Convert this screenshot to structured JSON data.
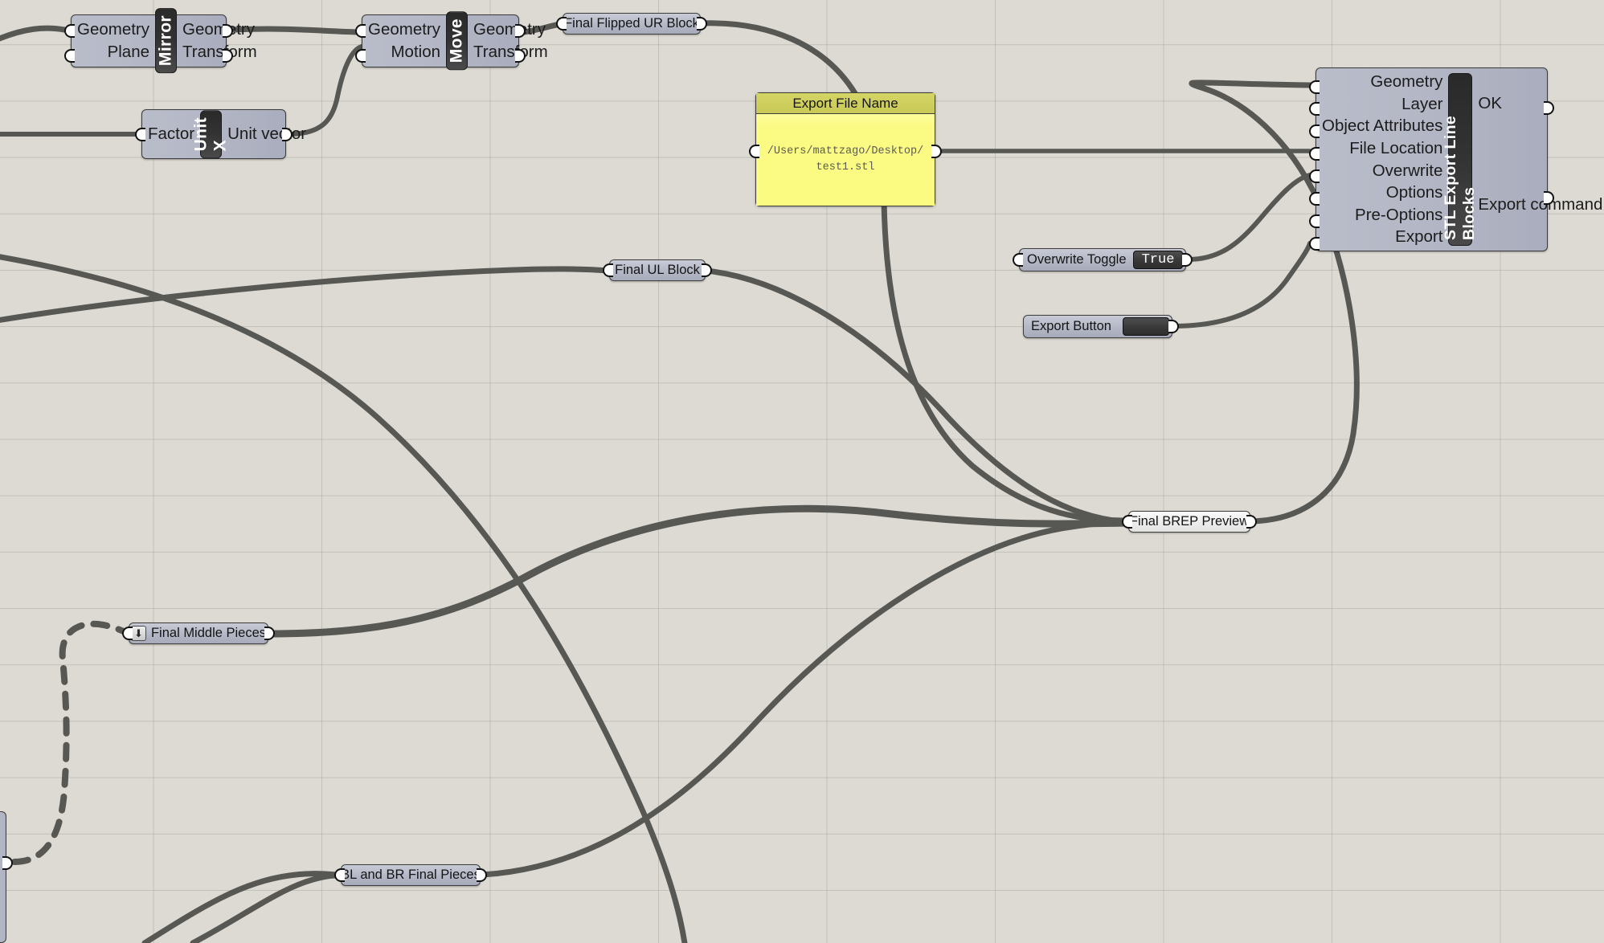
{
  "app": {
    "name": "Grasshopper Canvas",
    "background_color": "#dcdad2",
    "grid_line_color": "#96968f"
  },
  "components": [
    {
      "id": "mirror",
      "name": "Mirror",
      "nameplate": "Mirror",
      "inputs": [
        "Geometry",
        "Plane"
      ],
      "outputs": [
        "Geometry",
        "Transform"
      ]
    },
    {
      "id": "move",
      "name": "Move",
      "nameplate": "Move",
      "inputs": [
        "Geometry",
        "Motion"
      ],
      "outputs": [
        "Geometry",
        "Transform"
      ]
    },
    {
      "id": "unitx",
      "name": "Unit X",
      "nameplate": "Unit X",
      "inputs": [
        "Factor"
      ],
      "outputs": [
        "Unit vector"
      ]
    },
    {
      "id": "stl_export",
      "name": "STL Export Line Blocks",
      "nameplate": "STL Export Line Blocks",
      "inputs": [
        "Geometry",
        "Layer",
        "Object Attributes",
        "File Location",
        "Overwrite",
        "Options",
        "Pre-Options",
        "Export"
      ],
      "outputs": [
        "OK",
        "Export command"
      ]
    }
  ],
  "panel": {
    "title": "Export File Name",
    "value": "/Users/mattzago/Desktop/test1.stl",
    "header_color": "#cdcd5c",
    "body_color": "#fbfb84"
  },
  "widgets": [
    {
      "id": "overwrite_toggle",
      "label": "Overwrite Toggle",
      "value": "True",
      "kind": "boolean-toggle"
    },
    {
      "id": "export_button",
      "label": "Export Button",
      "value": "",
      "kind": "momentary-button"
    }
  ],
  "relays": [
    {
      "id": "final_flipped_ur",
      "label": "Final Flipped UR Block",
      "icon": "",
      "style": "default"
    },
    {
      "id": "final_ul",
      "label": "Final UL Block",
      "icon": "",
      "style": "default"
    },
    {
      "id": "final_middle",
      "label": "Final Middle Pieces",
      "icon": "arrow-down-icon",
      "icon_glyph": "⬇",
      "style": "default"
    },
    {
      "id": "final_brep",
      "label": "Final BREP Preview",
      "icon": "",
      "style": "light"
    },
    {
      "id": "bl_br_final",
      "label": "BL and BR Final Pieces",
      "icon": "",
      "style": "default"
    }
  ]
}
